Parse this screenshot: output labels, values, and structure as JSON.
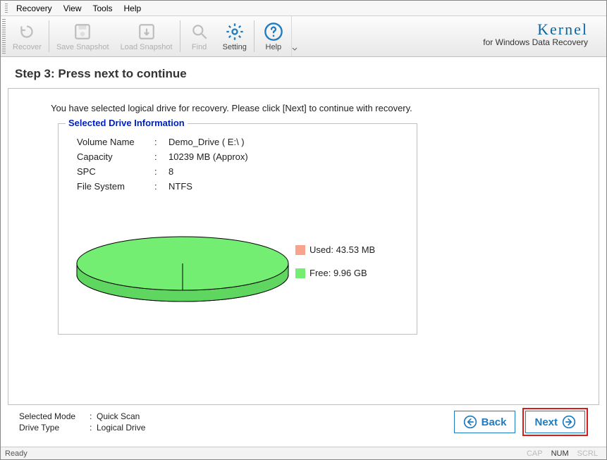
{
  "menu": {
    "items": [
      "Recovery",
      "View",
      "Tools",
      "Help"
    ]
  },
  "toolbar": {
    "recover": "Recover",
    "save_snapshot": "Save Snapshot",
    "load_snapshot": "Load Snapshot",
    "find": "Find",
    "setting": "Setting",
    "help": "Help"
  },
  "brand": {
    "name": "Kernel",
    "tagline": "for Windows Data Recovery"
  },
  "step": {
    "title": "Step 3: Press next to continue"
  },
  "instruction": "You have selected logical drive for recovery. Please click [Next] to continue with recovery.",
  "drive_info": {
    "legend": "Selected Drive Information",
    "rows": [
      {
        "label": "Volume Name",
        "value": "Demo_Drive ( E:\\ )"
      },
      {
        "label": "Capacity",
        "value": "10239 MB (Approx)"
      },
      {
        "label": "SPC",
        "value": "8"
      },
      {
        "label": "File System",
        "value": "NTFS"
      }
    ]
  },
  "chart_data": {
    "type": "pie",
    "title": "",
    "series": [
      {
        "name": "Used",
        "label": "Used: 43.53 MB",
        "value_mb": 43.53,
        "color": "#f7a48b"
      },
      {
        "name": "Free",
        "label": "Free: 9.96 GB",
        "value_mb": 10199.04,
        "color": "#73ee73"
      }
    ]
  },
  "footer": {
    "mode_label": "Selected Mode",
    "mode_value": "Quick Scan",
    "type_label": "Drive Type",
    "type_value": "Logical Drive",
    "back": "Back",
    "next": "Next"
  },
  "status": {
    "ready": "Ready",
    "cap": "CAP",
    "num": "NUM",
    "scrl": "SCRL"
  }
}
